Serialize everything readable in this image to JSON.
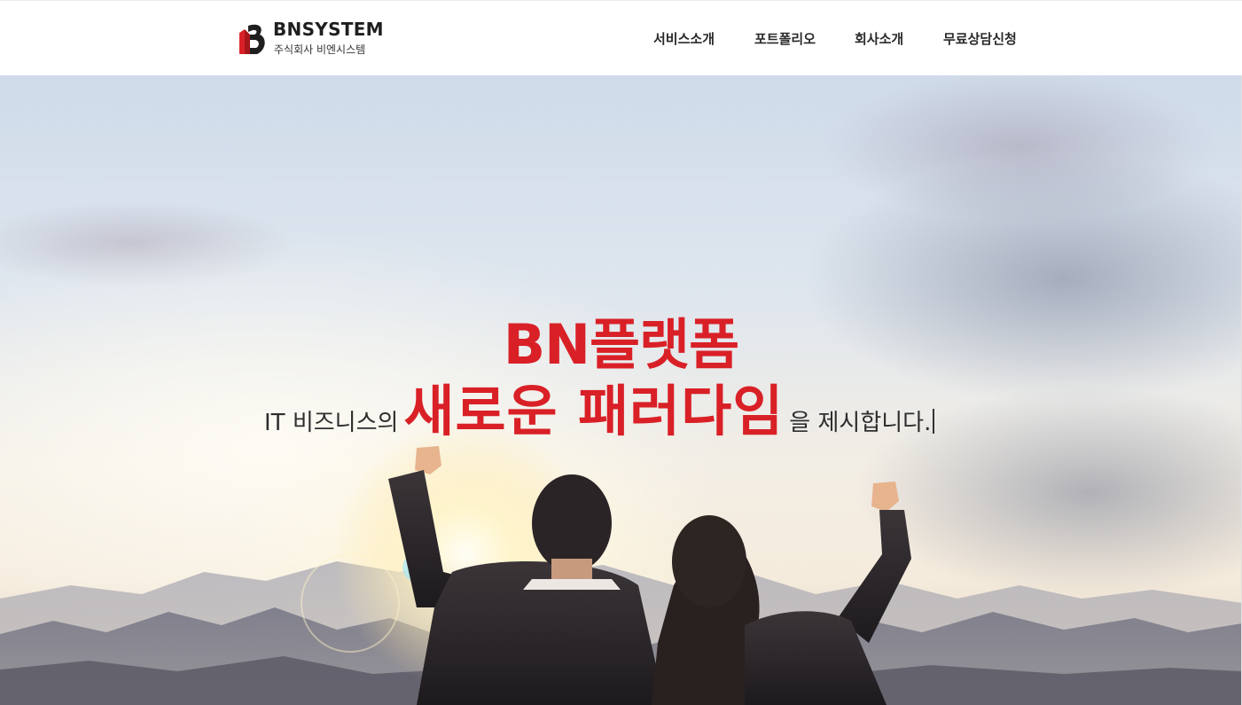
{
  "logo": {
    "name": "BNSYSTEM",
    "sub": "주식회사 비엔시스템",
    "colors": {
      "red": "#d92027",
      "dark": "#1f1f1f"
    }
  },
  "nav": {
    "items": [
      {
        "label": "서비스소개"
      },
      {
        "label": "포트폴리오"
      },
      {
        "label": "회사소개"
      },
      {
        "label": "무료상담신청"
      }
    ]
  },
  "hero": {
    "headline_line1": "BN플랫폼",
    "headline_prefix": "IT 비즈니스의",
    "headline_emphasis": "새로운 패러다임",
    "headline_suffix": "을 제시합니다.",
    "accent_color": "#d92027",
    "image_subject": "two business people raising fists toward sunrise over mountains"
  }
}
